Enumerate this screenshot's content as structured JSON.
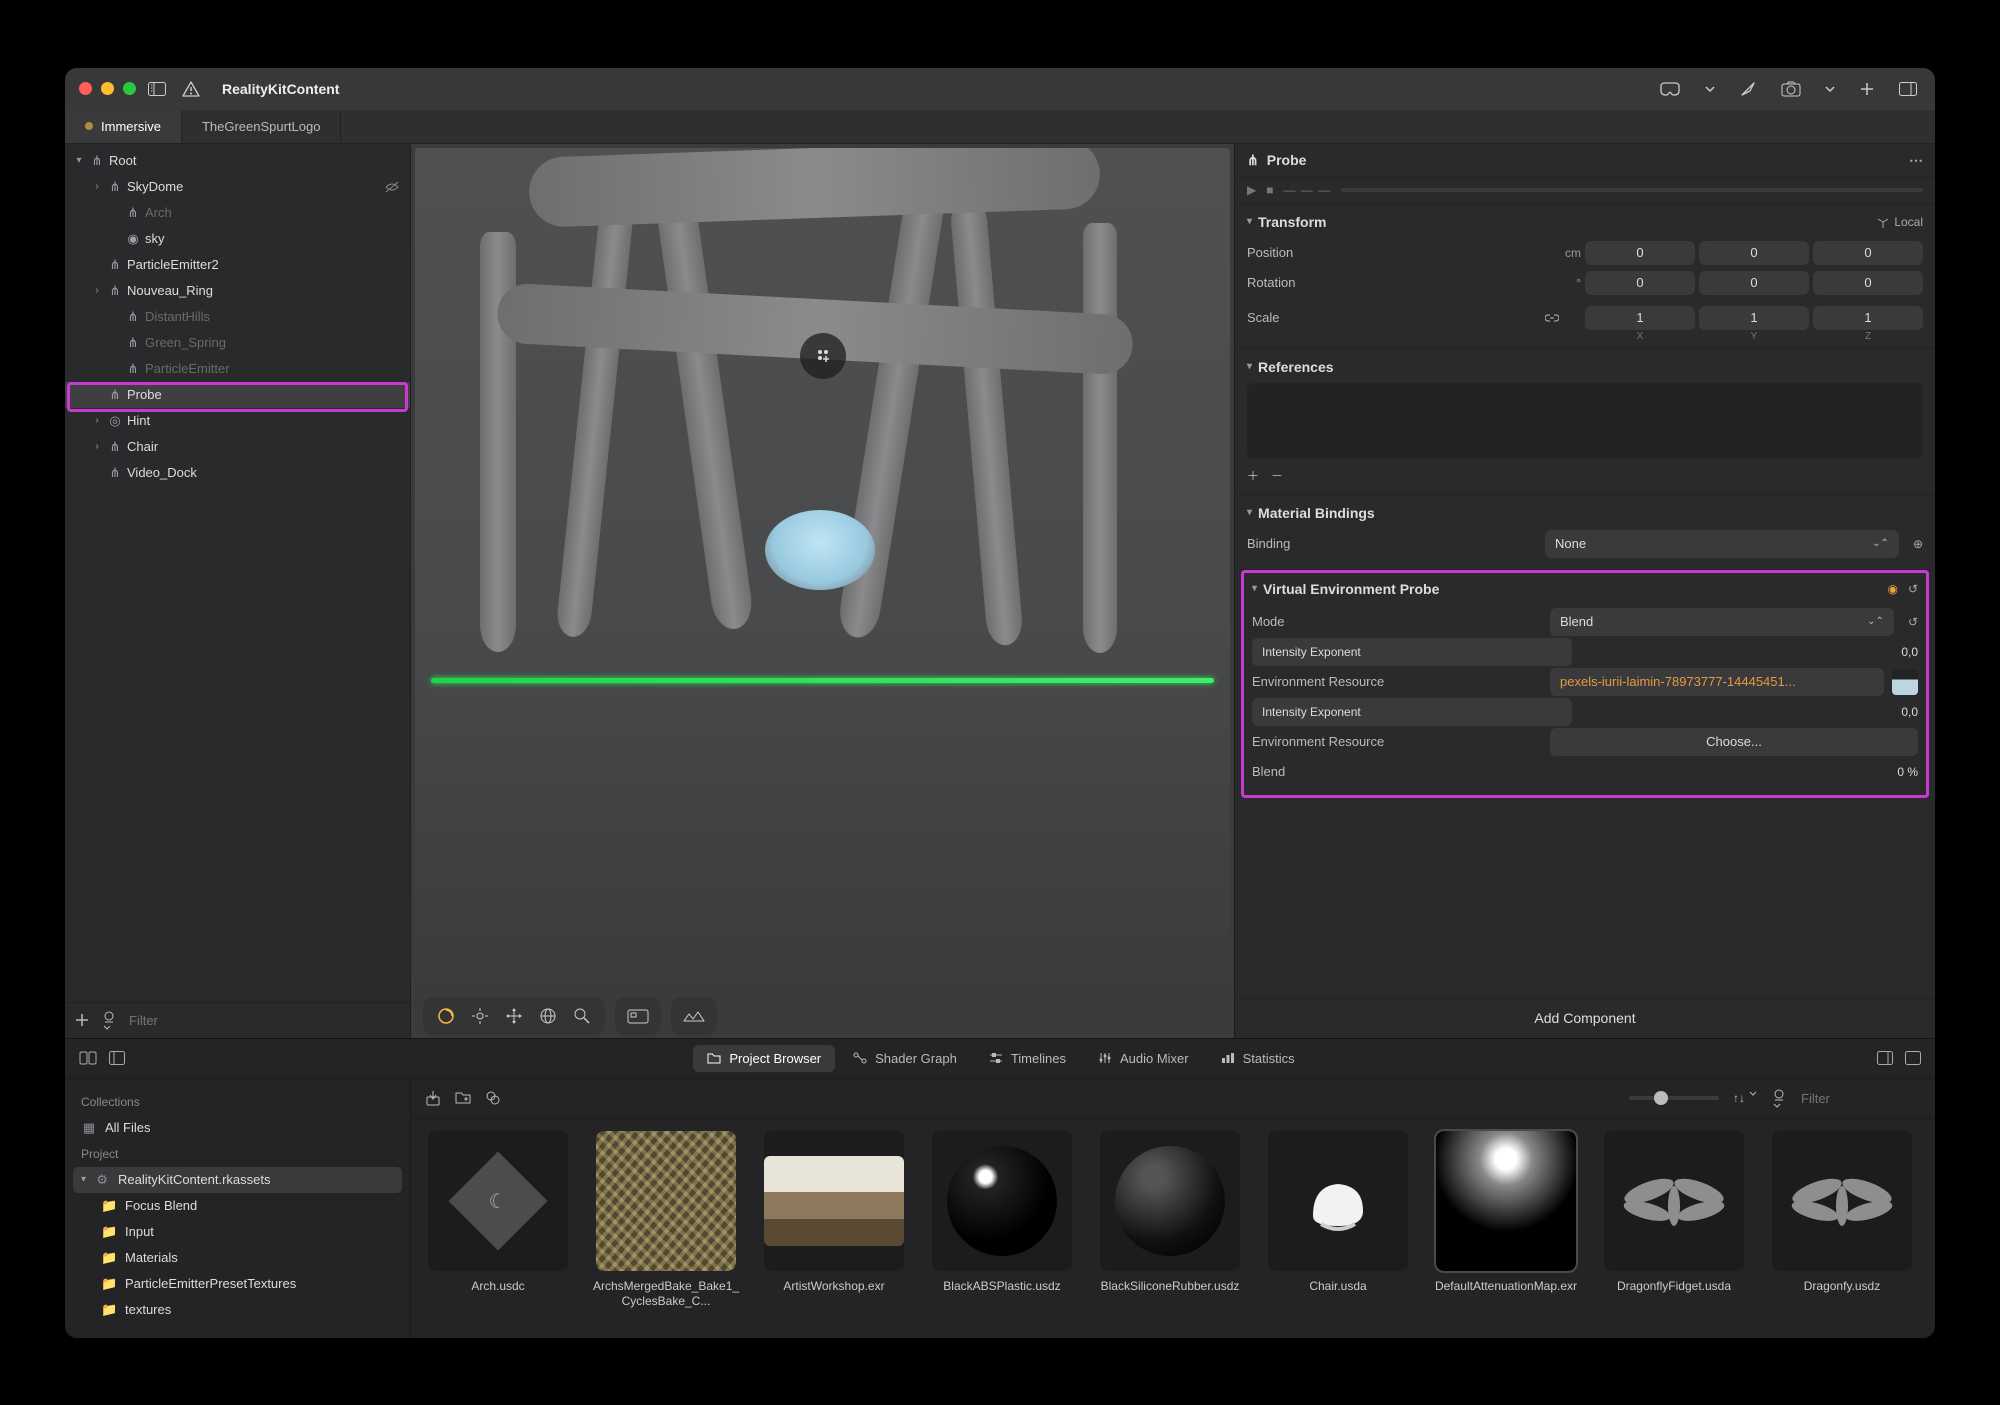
{
  "titlebar": {
    "app_title": "RealityKitContent"
  },
  "tabs": [
    {
      "label": "Immersive",
      "active": true,
      "dirty": true
    },
    {
      "label": "TheGreenSpurtLogo",
      "active": false,
      "dirty": false
    }
  ],
  "hierarchy": {
    "root": "Root",
    "items": [
      {
        "label": "SkyDome",
        "indent": 1,
        "expand": true,
        "hidden_icon": true
      },
      {
        "label": "Arch",
        "indent": 2,
        "dim": true
      },
      {
        "label": "sky",
        "indent": 2
      },
      {
        "label": "ParticleEmitter2",
        "indent": 1
      },
      {
        "label": "Nouveau_Ring",
        "indent": 1,
        "expand": true
      },
      {
        "label": "DistantHills",
        "indent": 2,
        "dim": true
      },
      {
        "label": "Green_Spring",
        "indent": 2,
        "dim": true
      },
      {
        "label": "ParticleEmitter",
        "indent": 2,
        "dim": true
      },
      {
        "label": "Probe",
        "indent": 1,
        "selected": true
      },
      {
        "label": "Hint",
        "indent": 1,
        "expand": true
      },
      {
        "label": "Chair",
        "indent": 1,
        "expand": true
      },
      {
        "label": "Video_Dock",
        "indent": 1
      }
    ],
    "filter_placeholder": "Filter"
  },
  "inspector": {
    "title": "Probe",
    "transform": {
      "title": "Transform",
      "local": "Local",
      "position": {
        "label": "Position",
        "unit": "cm",
        "x": "0",
        "y": "0",
        "z": "0"
      },
      "rotation": {
        "label": "Rotation",
        "unit": "°",
        "x": "0",
        "y": "0",
        "z": "0"
      },
      "scale": {
        "label": "Scale",
        "x": "1",
        "y": "1",
        "z": "1"
      },
      "axes": {
        "x": "X",
        "y": "Y",
        "z": "Z"
      }
    },
    "references": {
      "title": "References"
    },
    "material_bindings": {
      "title": "Material Bindings",
      "binding_label": "Binding",
      "binding_value": "None"
    },
    "vep": {
      "title": "Virtual Environment Probe",
      "mode_label": "Mode",
      "mode_value": "Blend",
      "intensity1_label": "Intensity Exponent",
      "intensity1_value": "0,0",
      "env1_label": "Environment Resource",
      "env1_value": "pexels-iurii-laimin-78973777-14445451...",
      "intensity2_label": "Intensity Exponent",
      "intensity2_value": "0,0",
      "env2_label": "Environment Resource",
      "env2_button": "Choose...",
      "blend_label": "Blend",
      "blend_value": "0 %"
    },
    "add_component": "Add Component"
  },
  "bottom": {
    "tabs": {
      "project_browser": "Project Browser",
      "shader_graph": "Shader Graph",
      "timelines": "Timelines",
      "audio_mixer": "Audio Mixer",
      "statistics": "Statistics"
    },
    "left": {
      "collections": "Collections",
      "all_files": "All Files",
      "project": "Project",
      "rkassets": "RealityKitContent.rkassets",
      "folders": [
        "Focus Blend",
        "Input",
        "Materials",
        "ParticleEmitterPresetTextures",
        "textures"
      ]
    },
    "filter_placeholder": "Filter",
    "assets": [
      {
        "name": "Arch.usdc",
        "kind": "diamond"
      },
      {
        "name": "ArchsMergedBake_Bake1_CyclesBake_C...",
        "kind": "noise"
      },
      {
        "name": "ArtistWorkshop.exr",
        "kind": "hdr"
      },
      {
        "name": "BlackABSPlastic.usdz",
        "kind": "sphere-gloss"
      },
      {
        "name": "BlackSiliconeRubber.usdz",
        "kind": "sphere-matte"
      },
      {
        "name": "Chair.usda",
        "kind": "chair"
      },
      {
        "name": "DefaultAttenuationMap.exr",
        "kind": "spot",
        "selected": true
      },
      {
        "name": "DragonflyFidget.usda",
        "kind": "dragonfly"
      },
      {
        "name": "Dragonfy.usdz",
        "kind": "dragonfly"
      }
    ]
  }
}
